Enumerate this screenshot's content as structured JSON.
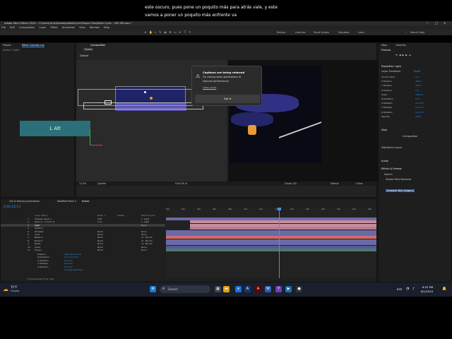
{
  "subtitle": {
    "line1": "este oscuro, pues pone un poquito más para atrás vale, y este",
    "line2": "vamos a poner un poquito más enfrente va"
  },
  "window": {
    "title": "Adobe After Effects 2024 - C:\\Users\\Ulrik\\Desktop\\WalkCycle\\Project Files\\Walk Cycle - V05 MM.aep *",
    "minimize": "─",
    "maximize": "□",
    "close": "✕"
  },
  "menu": [
    "File",
    "Edit",
    "Composition",
    "Layer",
    "Effect",
    "Animation",
    "View",
    "Window",
    "Help"
  ],
  "workspaces": [
    "Review",
    "Libraries",
    "Small Screen",
    "Standard",
    "Learn"
  ],
  "workspace_search": "Search Help",
  "project_panel": {
    "tabs": [
      "Project",
      "Effect Controls Luz"
    ],
    "breadcrumb": "Scene • Light"
  },
  "comp_panel": {
    "tab": "Composition",
    "comp_name": "Scene",
    "view_label": "Default",
    "zoom": "11.5%",
    "quality": "Quarter",
    "timecode": "0:00:16:13",
    "light_label": "L Alt",
    "renderer": "Classic 3D",
    "view_mode": "Default",
    "views": "1 View"
  },
  "notification": {
    "title": "Captions are being reduced",
    "body_line1": "Try closing some applications to",
    "body_line2": "improve performance.",
    "link": "Learn more",
    "button": "Got it"
  },
  "right_panel": {
    "tabs": [
      "Align",
      "Libraries"
    ],
    "preview_title": "Preview",
    "properties_title": "Properties: Light",
    "layer_transform": "Layer Transform",
    "reset": "Reset",
    "properties": [
      {
        "name": "Anchor Point",
        "value": "0.0"
      },
      {
        "name": "X Position",
        "value": "499.1"
      },
      {
        "name": "Y Position",
        "value": "324.5"
      },
      {
        "name": "Z Position",
        "value": "0.0"
      },
      {
        "name": "Scale",
        "value": "100.0%"
      },
      {
        "name": "Orientation",
        "value": "0.0°"
      },
      {
        "name": "X Rotation",
        "value": "0x+0.0°"
      },
      {
        "name": "Y Rotation",
        "value": "0x+0.0°"
      },
      {
        "name": "Z Rotation",
        "value": "0x+0.0°"
      },
      {
        "name": "Opacity",
        "value": "100%"
      }
    ],
    "align_title": "Align",
    "align_to": "Composition",
    "distribute": "Distribute Layers",
    "effects_title": "Effects & Presets",
    "effects_search": "Search",
    "effects_items": [
      "Simple Wire Removal",
      "Gaussian Blur (Legacy)"
    ],
    "audio_title": "Audio"
  },
  "timeline": {
    "tabs": [
      "Girl & Running Animation",
      "Modified Rock 2",
      "Scene"
    ],
    "timecode": "0:00:16:13",
    "columns": [
      "Layer Name",
      "Mode",
      "T",
      "TrkMat",
      "Parent & Link"
    ],
    "layers": [
      {
        "num": "1",
        "name": "Shadow Layer 1",
        "mode": "Soft",
        "parent": "1. Light"
      },
      {
        "num": "2",
        "name": "[Pale Cr...k Solid 1]",
        "mode": "Scre",
        "parent": "1. Light"
      },
      {
        "num": "3",
        "name": "Light",
        "mode": "",
        "parent": "None"
      },
      {
        "num": "4",
        "name": "Position",
        "mode": "",
        "parent": ""
      },
      {
        "num": "5",
        "name": "Estrellas",
        "mode": "Norm",
        "parent": "None"
      },
      {
        "num": "6",
        "name": "Luna",
        "mode": "Norm",
        "parent": "None"
      },
      {
        "num": "7",
        "name": "Bañel 3",
        "mode": "Norm",
        "parent": "11. Mundo"
      },
      {
        "num": "8",
        "name": "Bañel 2",
        "mode": "Norm",
        "parent": "11. Mundo"
      },
      {
        "num": "9",
        "name": "Bañel",
        "mode": "Norm",
        "parent": "11. Mundo"
      },
      {
        "num": "10",
        "name": "Suelo",
        "mode": "Norm",
        "parent": "None"
      },
      {
        "num": "11",
        "name": "Mundo",
        "mode": "Norm",
        "parent": "None"
      }
    ],
    "sub_props": [
      {
        "name": "Position",
        "value": "499.1,324.5,0.0"
      },
      {
        "name": "Orientation",
        "value": "0.0°,0.0°,0.0°"
      },
      {
        "name": "X Rotation",
        "value": "0x+0.0°"
      },
      {
        "name": "Y Rotation",
        "value": "0x+0.0°"
      },
      {
        "name": "Z Rotation",
        "value": "0x+0.0°"
      }
    ],
    "change_renderer": "Change Renderer...",
    "render_time": "Frame Render Time: 9ms",
    "ruler": [
      "00s",
      "02s",
      "04s",
      "06s",
      "08s",
      "10s",
      "12s",
      "14s",
      "16s",
      "18s",
      "20s",
      "22s",
      "24s",
      "26s"
    ]
  },
  "taskbar": {
    "weather_temp": "71°F",
    "weather_text": "Cloudy",
    "search_placeholder": "Search",
    "lang": "ESP",
    "time": "6:22 PM",
    "date": "8/1/2024"
  },
  "colors": {
    "accent": "#2d8ceb",
    "timeline_purple": "#6a6aa8",
    "timeline_pink": "#c88d9c",
    "teal_box": "#2b6f78",
    "playhead": "#4a90e2"
  }
}
